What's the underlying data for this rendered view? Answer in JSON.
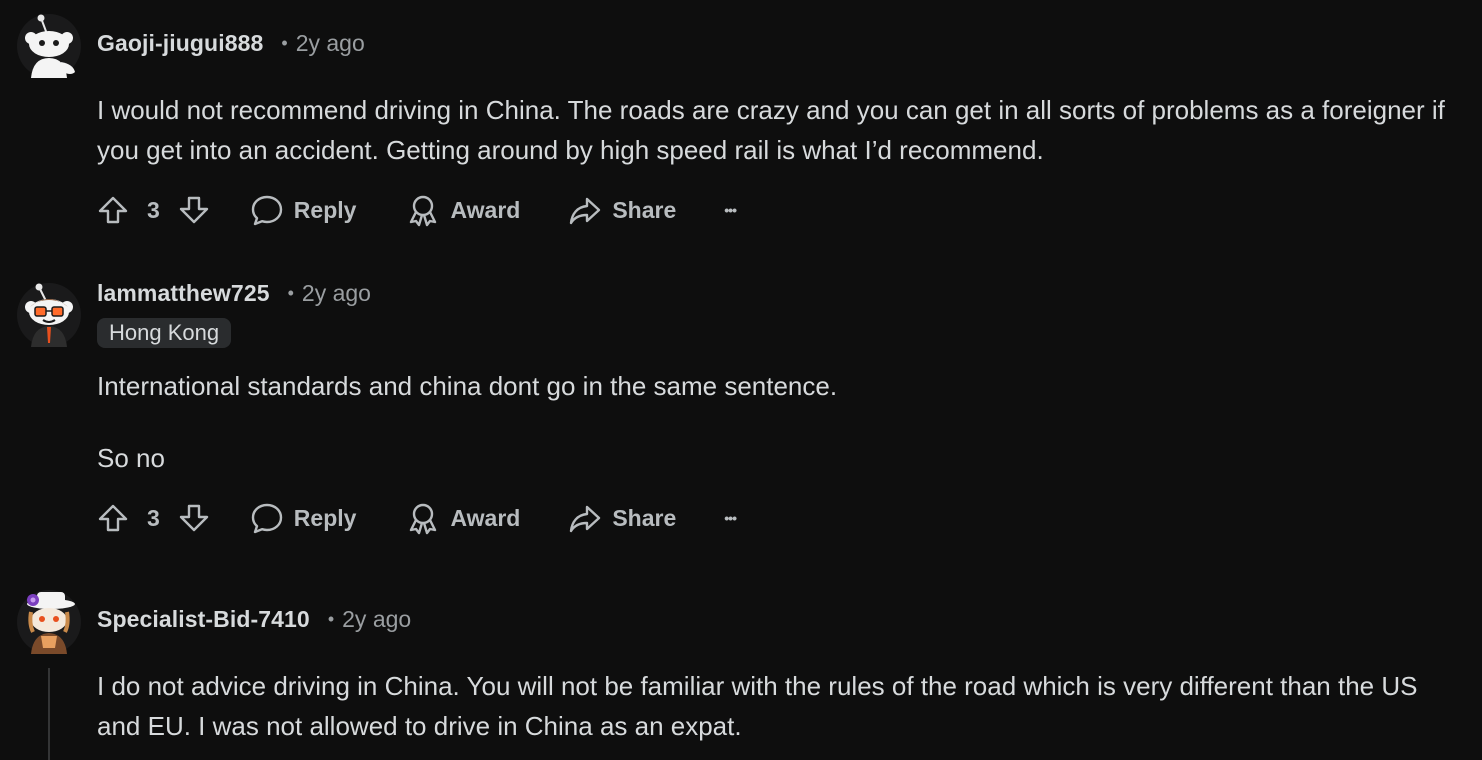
{
  "comments": [
    {
      "username": "Gaoji-jiugui888",
      "time": "2y ago",
      "body": [
        "I would not recommend driving in China. The roads are crazy and you can get in all sorts of problems as a foreigner if you get into an accident. Getting around by high speed rail is what I’d recommend."
      ],
      "votes": "3",
      "actions": {
        "reply": "Reply",
        "award": "Award",
        "share": "Share",
        "more": "•••"
      }
    },
    {
      "username": "lammatthew725",
      "time": "2y ago",
      "flair": "Hong Kong",
      "body": [
        "International standards and china dont go in the same sentence.",
        "So no"
      ],
      "votes": "3",
      "actions": {
        "reply": "Reply",
        "award": "Award",
        "share": "Share",
        "more": "•••"
      }
    },
    {
      "username": "Specialist-Bid-7410",
      "time": "2y ago",
      "body": [
        "I do not advice driving in China. You will not be familiar with the rules of the road which is very different than the US and EU. I was not allowed to drive in China as an expat."
      ]
    }
  ],
  "separator": "•",
  "icons": {
    "upvote": "upvote-arrow-icon",
    "downvote": "downvote-arrow-icon",
    "reply": "speech-bubble-icon",
    "award": "award-ribbon-icon",
    "share": "share-arrow-icon"
  },
  "colors": {
    "background": "#0e0e0e",
    "text": "#d7dadc",
    "muted": "#9a9ea1",
    "flair_bg": "#2a2c2e"
  }
}
